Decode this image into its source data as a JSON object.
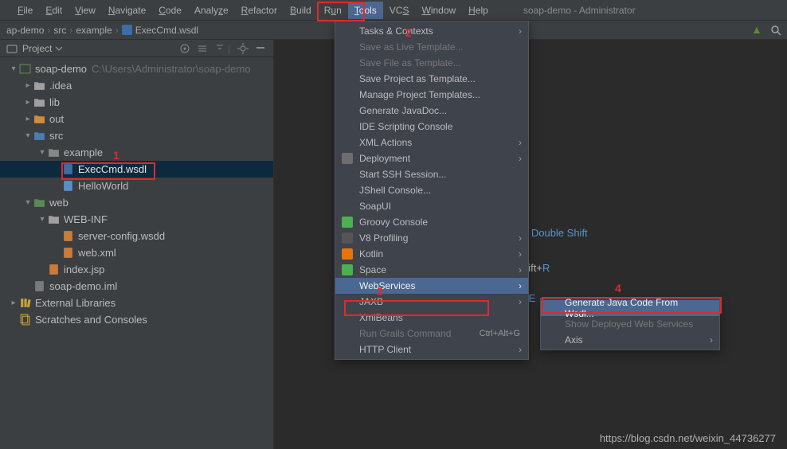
{
  "window_title": "soap-demo - Administrator",
  "menubar": {
    "items": [
      "File",
      "Edit",
      "View",
      "Navigate",
      "Code",
      "Analyze",
      "Refactor",
      "Build",
      "Run",
      "Tools",
      "VCS",
      "Window",
      "Help"
    ]
  },
  "breadcrumbs": [
    "ap-demo",
    "src",
    "example",
    "ExecCmd.wsdl"
  ],
  "project_panel": {
    "title": "Project",
    "tree": [
      {
        "i": 0,
        "exp": true,
        "type": "module",
        "label": "soap-demo",
        "hint": "C:\\Users\\Administrator\\soap-demo"
      },
      {
        "i": 1,
        "exp": false,
        "type": "folder",
        "label": ".idea"
      },
      {
        "i": 1,
        "exp": false,
        "type": "folder",
        "label": "lib"
      },
      {
        "i": 1,
        "exp": false,
        "type": "folder-out",
        "label": "out"
      },
      {
        "i": 1,
        "exp": true,
        "type": "folder-src",
        "label": "src"
      },
      {
        "i": 2,
        "exp": true,
        "type": "pkg",
        "label": "example"
      },
      {
        "i": 3,
        "exp": null,
        "type": "wsdl",
        "label": "ExecCmd.wsdl",
        "selected": true
      },
      {
        "i": 3,
        "exp": null,
        "type": "class",
        "label": "HelloWorld"
      },
      {
        "i": 1,
        "exp": true,
        "type": "folder-web",
        "label": "web"
      },
      {
        "i": 2,
        "exp": true,
        "type": "folder",
        "label": "WEB-INF"
      },
      {
        "i": 3,
        "exp": null,
        "type": "cfg",
        "label": "server-config.wsdd"
      },
      {
        "i": 3,
        "exp": null,
        "type": "xml",
        "label": "web.xml"
      },
      {
        "i": 2,
        "exp": null,
        "type": "jsp",
        "label": "index.jsp"
      },
      {
        "i": 1,
        "exp": null,
        "type": "iml",
        "label": "soap-demo.iml"
      },
      {
        "i": 0,
        "exp": false,
        "type": "lib",
        "label": "External Libraries"
      },
      {
        "i": 0,
        "exp": null,
        "type": "scratch",
        "label": "Scratches and Consoles"
      }
    ]
  },
  "editor_hints": {
    "h1_prefix": "e ",
    "h1": "Double Shift",
    "h2_prefix": "hift+",
    "h2": "R",
    "h3_prefix": "+",
    "h3": "E"
  },
  "tools_menu": [
    {
      "label": "Tasks & Contexts",
      "sub": true
    },
    {
      "label": "Save as Live Template...",
      "disabled": true
    },
    {
      "label": "Save File as Template...",
      "disabled": true
    },
    {
      "label": "Save Project as Template..."
    },
    {
      "label": "Manage Project Templates..."
    },
    {
      "label": "Generate JavaDoc..."
    },
    {
      "label": "IDE Scripting Console"
    },
    {
      "label": "XML Actions",
      "sub": true
    },
    {
      "label": "Deployment",
      "sub": true,
      "icon": "#6e6e6e"
    },
    {
      "label": "Start SSH Session..."
    },
    {
      "label": "JShell Console..."
    },
    {
      "label": "SoapUI"
    },
    {
      "label": "Groovy Console",
      "icon": "#4caf50"
    },
    {
      "label": "V8 Profiling",
      "sub": true,
      "icon": "#555"
    },
    {
      "label": "Kotlin",
      "sub": true,
      "icon": "#e8730c"
    },
    {
      "label": "Space",
      "sub": true,
      "icon": "#4caf50"
    },
    {
      "label": "WebServices",
      "sub": true,
      "hi": true
    },
    {
      "label": "JAXB",
      "sub": true
    },
    {
      "label": "XmlBeans"
    },
    {
      "label": "Run Grails Command",
      "disabled": true,
      "shortcut": "Ctrl+Alt+G"
    },
    {
      "label": "HTTP Client",
      "sub": true
    }
  ],
  "submenu": [
    {
      "label": "Generate Java Code From Wsdl...",
      "hi": true
    },
    {
      "label": "Show Deployed Web Services",
      "disabled": true
    },
    {
      "label": "Axis",
      "sub": true
    }
  ],
  "annotations": {
    "n1": "1",
    "n2": "2",
    "n3": "3",
    "n4": "4"
  },
  "watermark": "https://blog.csdn.net/weixin_44736277"
}
